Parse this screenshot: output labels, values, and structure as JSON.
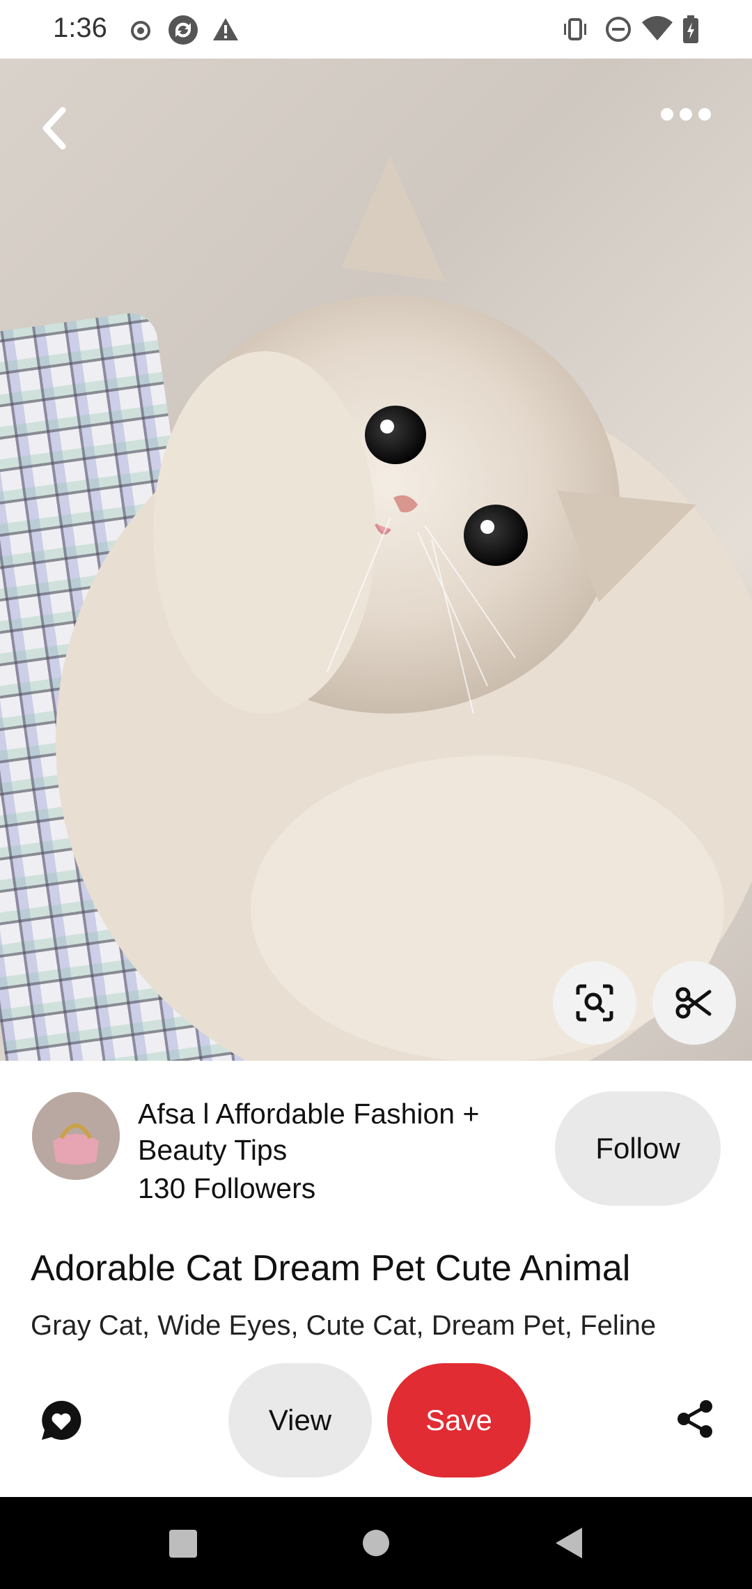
{
  "status_bar": {
    "time": "1:36",
    "left_icons": [
      "record-icon",
      "sync-icon",
      "warning-icon"
    ],
    "right_icons": [
      "vibrate-icon",
      "do-not-disturb-icon",
      "wifi-icon",
      "battery-icon"
    ]
  },
  "hero": {
    "image_alt_icon": "cat-photo",
    "back_icon": "chevron-left-icon",
    "more_icon": "more-horizontal-icon",
    "visual_search_icon": "visual-search-icon",
    "cutout_icon": "scissors-icon"
  },
  "creator": {
    "name": "Afsa l Affordable Fashion + Beauty Tips",
    "followers": "130 Followers",
    "follow_label": "Follow"
  },
  "pin": {
    "title": "Adorable Cat Dream Pet Cute Animal",
    "tags": "Gray Cat, Wide Eyes, Cute Cat, Dream Pet, Feline"
  },
  "actions": {
    "comment_icon": "comment-heart-icon",
    "view_label": "View",
    "save_label": "Save",
    "share_icon": "share-icon"
  },
  "colors": {
    "save_red": "#e02c32",
    "pill_gray": "#e9e9e9"
  },
  "nav_bar": {
    "icons": [
      "recents-square-icon",
      "home-circle-icon",
      "back-triangle-icon"
    ]
  }
}
